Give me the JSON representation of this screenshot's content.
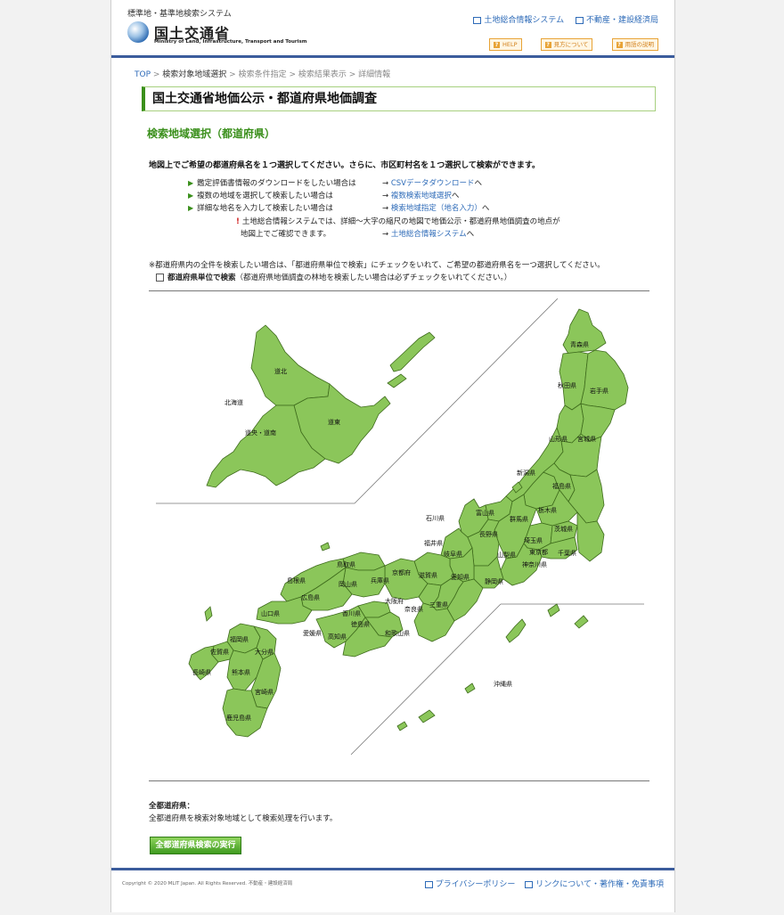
{
  "header": {
    "system_name": "標準地・基準地検索システム",
    "logo_ja": "国土交通省",
    "logo_en": "Ministry of Land, Infrastructure, Transport and Tourism",
    "link_land_info": "土地総合情報システム",
    "link_bureau": "不動産・建設経済局",
    "btn_help": "HELP",
    "btn_howto": "見方について",
    "btn_terms": "用語の説明"
  },
  "breadcrumb": {
    "top": "TOP",
    "step1": "検索対象地域選択",
    "step2": "検索条件指定",
    "step3": "検索結果表示",
    "step4": "詳細情報",
    "sep": " > "
  },
  "page_title": "国土交通省地価公示・都道府県地価調査",
  "section_title": "検索地域選択（都道府県）",
  "intro": "地図上でご希望の都道府県名を１つ選択してください。さらに、市区町村名を１つ選択して検索ができます。",
  "options": [
    {
      "text": "鑑定評価書情報のダウンロードをしたい場合は",
      "arrow": "→",
      "link": "CSVデータダウンロード",
      "suffix": "へ"
    },
    {
      "text": "複数の地域を選択して検索したい場合は",
      "arrow": "→",
      "link": "複数検索地域選択",
      "suffix": "へ"
    },
    {
      "text": "詳細な地名を入力して検索したい場合は",
      "arrow": "→",
      "link": "検索地域指定（地名入力）",
      "suffix": "へ"
    }
  ],
  "note": {
    "mark": "!",
    "line1": "土地総合情報システムでは、詳細～大字の縮尺の地図で地価公示・都道府県地価調査の地点が",
    "line2": "地図上でご確認できます。",
    "arrow": "→",
    "link": "土地総合情報システム",
    "suffix": "へ"
  },
  "all_note": "※都道府県内の全件を検索したい場合は、「都道府県単位で検索」にチェックをいれて、ご希望の都道府県名を一つ選択してください。",
  "checkbox": {
    "label": "都道府県単位で検索",
    "hint": "（都道府県地価調査の林地を検索したい場合は必ずチェックをいれてください。）"
  },
  "map": {
    "fill_color": "#8bc65a",
    "border_color": "#3e6b1c",
    "hokkaido": {
      "kita": "道北",
      "dou": "北海道",
      "higashi": "道東",
      "chuo": "道央・道南"
    },
    "prefectures": {
      "aomori": "青森県",
      "akita": "秋田県",
      "iwate": "岩手県",
      "yamagata": "山形県",
      "miyagi": "宮城県",
      "niigata": "新潟県",
      "fukushima": "福島県",
      "toyama": "富山県",
      "ishikawa": "石川県",
      "gunma": "群馬県",
      "tochigi": "栃木県",
      "ibaraki": "茨城県",
      "nagano": "長野県",
      "saitama": "埼玉県",
      "fukui": "福井県",
      "gifu": "岐阜県",
      "yamanashi": "山梨県",
      "tokyo": "東京都",
      "chiba": "千葉県",
      "kanagawa": "神奈川県",
      "tottori": "鳥取県",
      "kyoto": "京都府",
      "shimane": "島根県",
      "okayama": "岡山県",
      "hyogo": "兵庫県",
      "shiga": "滋賀県",
      "aichi": "愛知県",
      "shizuoka": "静岡県",
      "hiroshima": "広島県",
      "osaka": "大阪府",
      "nara": "奈良県",
      "mie": "三重県",
      "yamaguchi": "山口県",
      "kagawa": "香川県",
      "tokushima": "徳島県",
      "ehime": "愛媛県",
      "kochi": "高知県",
      "wakayama": "和歌山県",
      "fukuoka": "福岡県",
      "saga": "佐賀県",
      "oita": "大分県",
      "nagasaki": "長崎県",
      "kumamoto": "熊本県",
      "miyazaki": "宮崎県",
      "kagoshima": "鹿児島県",
      "okinawa": "沖縄県"
    }
  },
  "all_prefs": {
    "label": "全都道府県：",
    "desc": "全都道府県を検索対象地域として検索処理を行います。",
    "button": "全都道府県検索の実行"
  },
  "footer": {
    "copyright": "Copyright © 2020 MLIT Japan. All Rights Reserved. 不動産・建設経済局",
    "privacy": "プライバシーポリシー",
    "links": "リンクについて・著作権・免責事項"
  }
}
